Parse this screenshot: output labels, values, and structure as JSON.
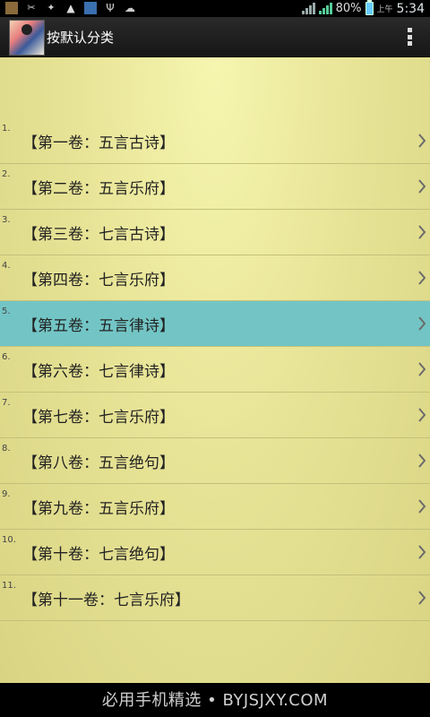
{
  "status_bar": {
    "battery": "80%",
    "ampm": "上午",
    "time": "5:34"
  },
  "action_bar": {
    "title": "按默认分类",
    "overflow_icon": "overflow-menu-icon"
  },
  "list": {
    "items": [
      {
        "num": "1.",
        "label": "【第一卷：五言古诗】"
      },
      {
        "num": "2.",
        "label": "【第二卷：五言乐府】"
      },
      {
        "num": "3.",
        "label": "【第三卷：七言古诗】"
      },
      {
        "num": "4.",
        "label": "【第四卷：七言乐府】"
      },
      {
        "num": "5.",
        "label": "【第五卷：五言律诗】"
      },
      {
        "num": "6.",
        "label": "【第六卷：七言律诗】"
      },
      {
        "num": "7.",
        "label": "【第七卷：七言乐府】"
      },
      {
        "num": "8.",
        "label": "【第八卷：五言绝句】"
      },
      {
        "num": "9.",
        "label": "【第九卷：五言乐府】"
      },
      {
        "num": "10.",
        "label": "【第十卷：七言绝句】"
      },
      {
        "num": "11.",
        "label": "【第十一卷：七言乐府】"
      }
    ],
    "selected_index": 4
  },
  "watermark": "必用手机精选 • BYJSJXY.COM",
  "colors": {
    "selected": "#73c5c5",
    "content_bg": "#e8e497"
  }
}
